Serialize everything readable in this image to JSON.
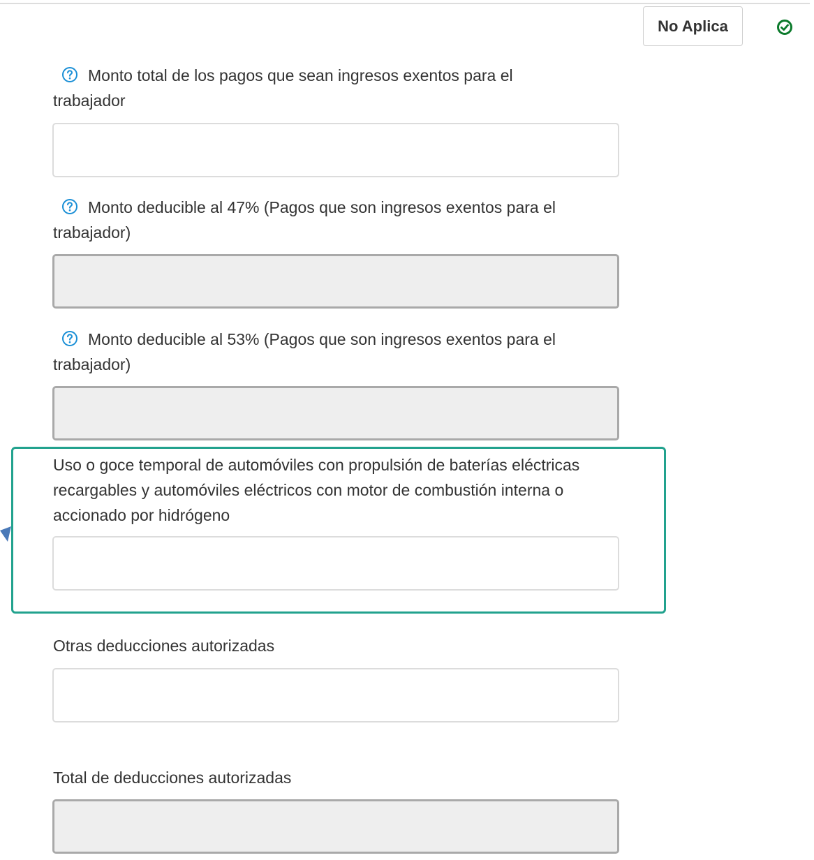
{
  "header": {
    "no_aplica_label": "No Aplica",
    "status_icon": "check-circle-icon",
    "status_color": "#0b7a2b"
  },
  "fields": [
    {
      "label": "Monto total de los pagos que sean ingresos exentos para el trabajador",
      "has_help": true,
      "value": "",
      "readonly": false
    },
    {
      "label": "Monto deducible al 47% (Pagos que son ingresos exentos para el trabajador)",
      "has_help": true,
      "value": "",
      "readonly": true
    },
    {
      "label": "Monto deducible al 53% (Pagos que son ingresos exentos para el trabajador)",
      "has_help": true,
      "value": "",
      "readonly": true
    },
    {
      "label": "Uso o goce temporal de automóviles con propulsión de baterías eléctricas recargables y automóviles eléctricos con motor de combustión interna o accionado por hidrógeno",
      "has_help": false,
      "value": "",
      "readonly": false,
      "highlighted": true
    },
    {
      "label": "Otras deducciones autorizadas",
      "has_help": false,
      "value": "",
      "readonly": false
    },
    {
      "label": "Total de deducciones autorizadas",
      "has_help": false,
      "value": "",
      "readonly": true
    }
  ],
  "colors": {
    "help_icon": "#1a8fd6",
    "highlight_border": "#22a28e",
    "pointer_arrow": "#4a79b8"
  }
}
